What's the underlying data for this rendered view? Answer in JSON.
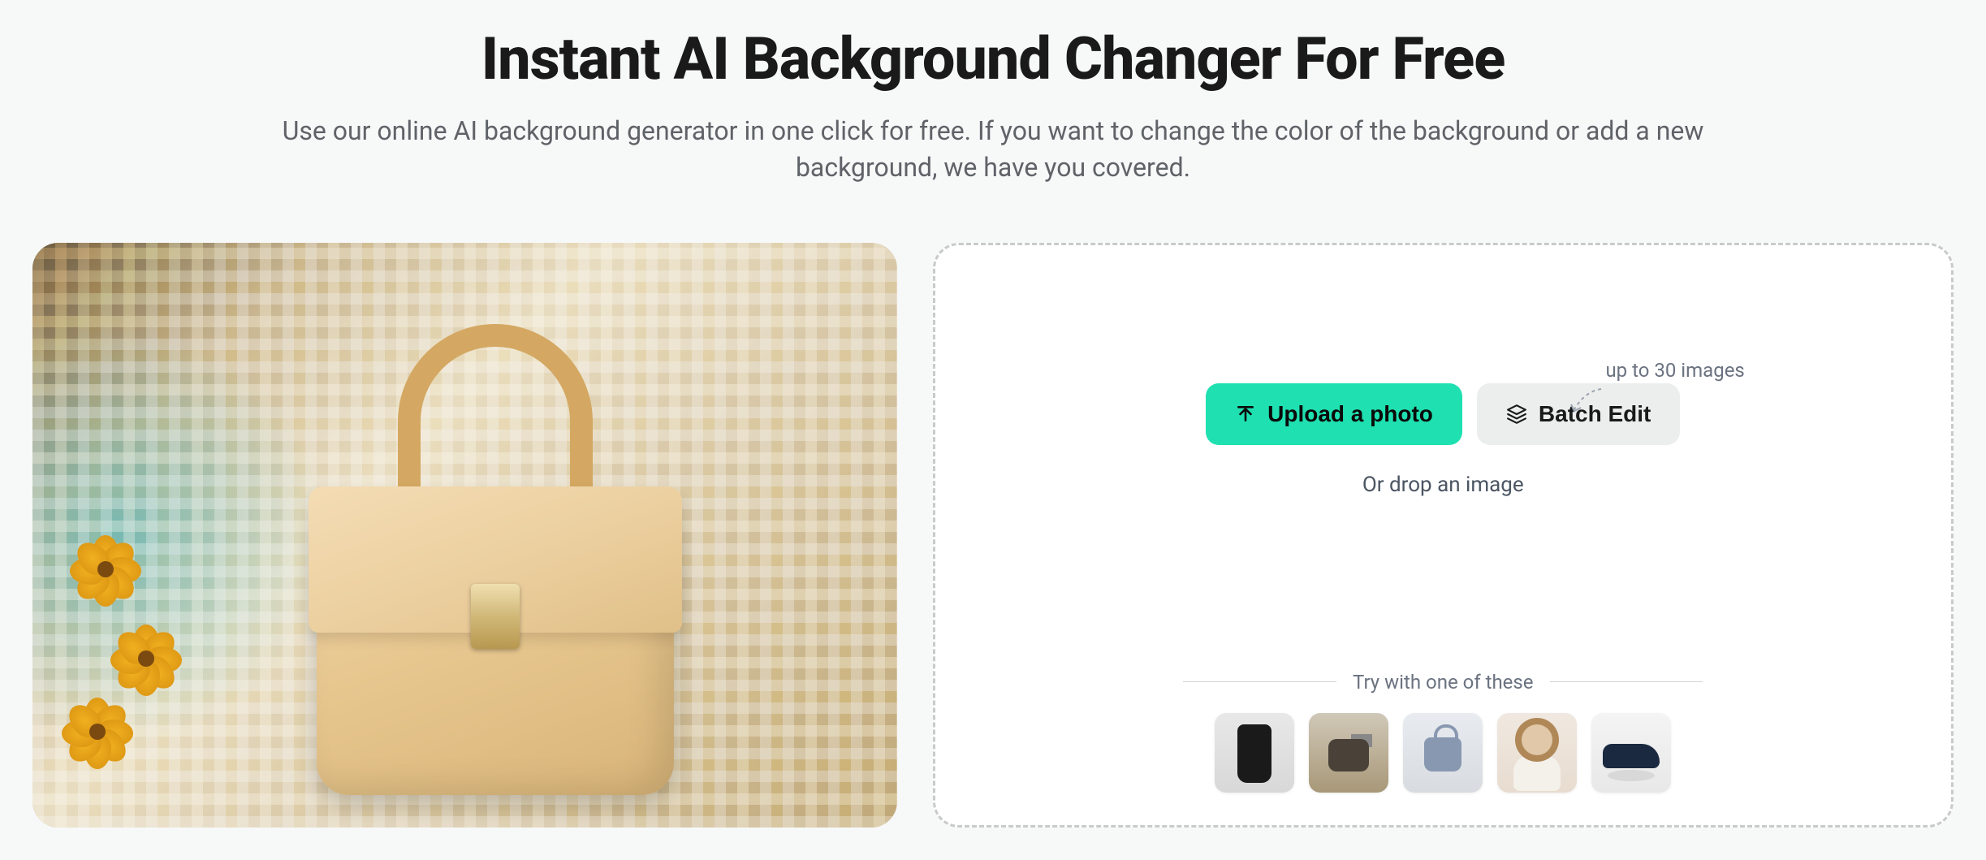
{
  "hero": {
    "title": "Instant AI Background Changer For Free",
    "subtitle": "Use our online AI background generator in one click for free. If you want to change the color of the background or add a new background, we have you covered."
  },
  "upload": {
    "hint": "up to 30 images",
    "primary_label": "Upload a photo",
    "secondary_label": "Batch Edit",
    "drop_text": "Or drop an image"
  },
  "samples": {
    "label": "Try with one of these",
    "items": [
      {
        "name": "coffee-cup"
      },
      {
        "name": "camera"
      },
      {
        "name": "handbag"
      },
      {
        "name": "woman-hat"
      },
      {
        "name": "shoes"
      }
    ]
  },
  "colors": {
    "primary": "#1fe0b0",
    "secondary_bg": "#eceeee",
    "text_muted": "#6b7280"
  }
}
